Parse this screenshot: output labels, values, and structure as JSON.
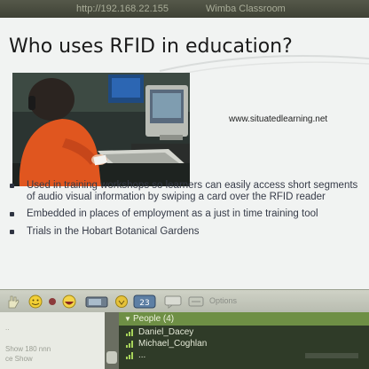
{
  "window": {
    "url_text": "http://192.168.22.155",
    "title_text": "Wimba Classroom"
  },
  "slide": {
    "title": "Who uses RFID in education?",
    "website": "www.situatedlearning.net",
    "bullets": [
      "Used in training workshops so learners can easily access short segments of audio visual information by swiping a card over the RFID reader",
      "Embedded in places of employment  as a just in time training tool",
      " Trials in the Hobart Botanical Gardens"
    ]
  },
  "controls": {
    "label": "Options"
  },
  "chat": {
    "lines": [
      "..",
      "Show 180 nnn",
      "ce Show"
    ]
  },
  "people": {
    "header": "People (4)",
    "list": [
      {
        "name": "Daniel_Dacey"
      },
      {
        "name": "Michael_Coghlan"
      },
      {
        "name": "..."
      }
    ]
  },
  "colors": {
    "people_header": "#6e8f45",
    "people_bg": "#2f3b28",
    "slide_bg": "#f1f3f2",
    "bullet_text": "#363b48"
  }
}
